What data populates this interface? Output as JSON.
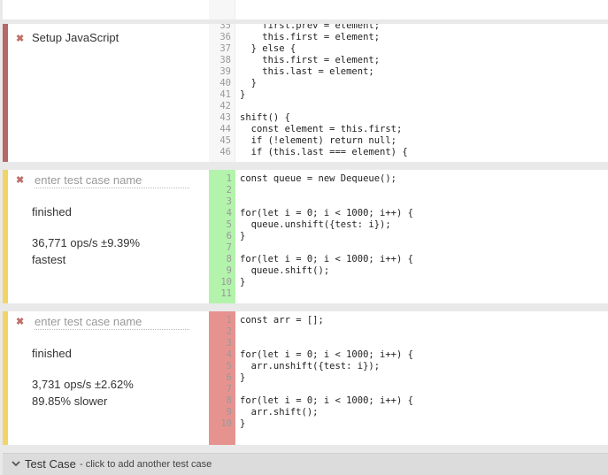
{
  "setup": {
    "label": "Setup JavaScript",
    "first_line": 35,
    "lines": [
      "    first.prev = element;",
      "    this.first = element;",
      "  } else {",
      "    this.first = element;",
      "    this.last = element;",
      "  }",
      "}",
      "",
      "shift() {",
      "  const element = this.first;",
      "  if (!element) return null;",
      "  if (this.last === element) {"
    ]
  },
  "test_cases": [
    {
      "name_placeholder": "enter test case name",
      "status": "finished",
      "ops": "36,771 ops/s ±9.39%",
      "rank": "fastest",
      "bar_color": "#f0d568",
      "gutter_color": "#b3f3ac",
      "lines": [
        "const queue = new Dequeue();",
        "",
        "",
        "for(let i = 0; i < 1000; i++) {",
        "  queue.unshift({test: i});",
        "}",
        "",
        "for(let i = 0; i < 1000; i++) {",
        "  queue.shift();",
        "}",
        ""
      ]
    },
    {
      "name_placeholder": "enter test case name",
      "status": "finished",
      "ops": "3,731 ops/s ±2.62%",
      "rank": "89.85% slower",
      "bar_color": "#f0d568",
      "gutter_color": "#e69390",
      "lines": [
        "const arr = [];",
        "",
        "",
        "for(let i = 0; i < 1000; i++) {",
        "  arr.unshift({test: i});",
        "}",
        "",
        "for(let i = 0; i < 1000; i++) {",
        "  arr.shift();",
        "}"
      ]
    }
  ],
  "footer": {
    "label": "Test Case",
    "hint": "- click to add another test case"
  },
  "icons": {
    "remove": "✖",
    "chevron": "chevron-down-icon"
  }
}
